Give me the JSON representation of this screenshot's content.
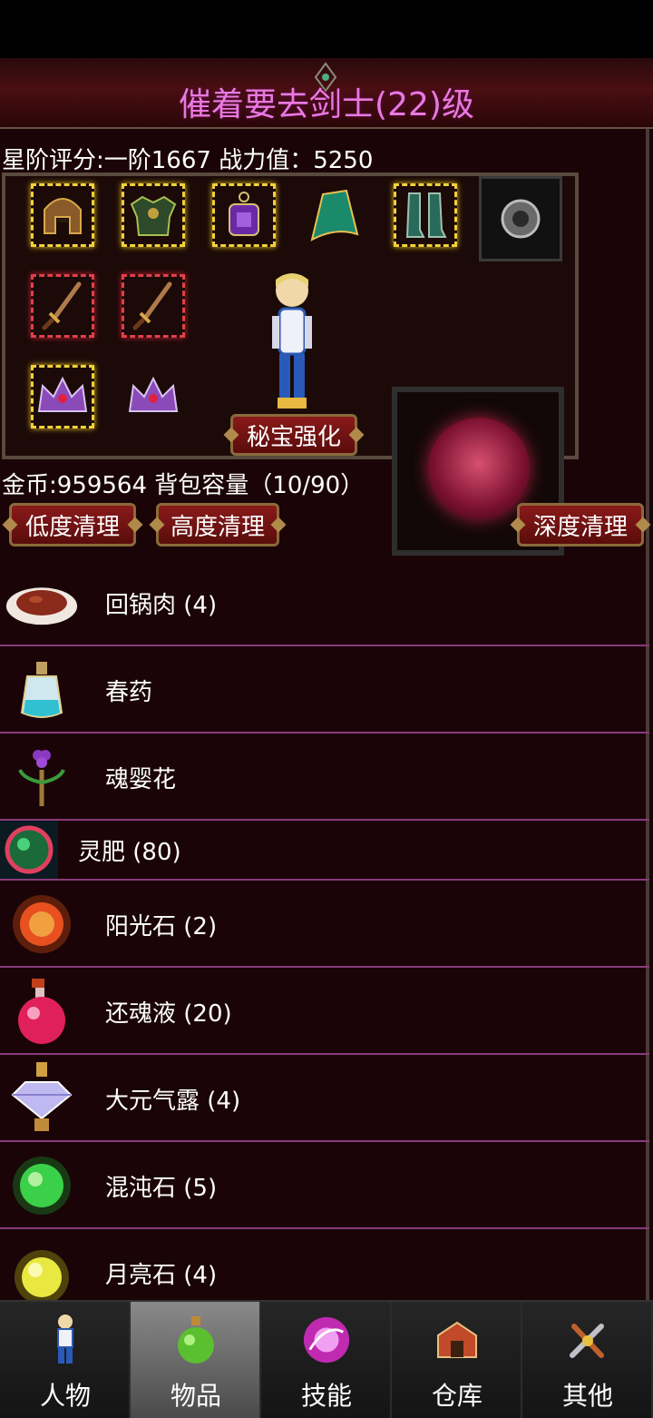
{
  "header": {
    "title": "催着要去剑士(22)级"
  },
  "stats": {
    "score_line": "星阶评分:一阶1667 战力值：5250"
  },
  "equipment": {
    "enhance_button": "秘宝强化",
    "slots": [
      {
        "icon": "helmet-icon",
        "state": "gold"
      },
      {
        "icon": "armor-icon",
        "state": "gold"
      },
      {
        "icon": "amulet-icon",
        "state": "gold"
      },
      {
        "icon": "cape-icon",
        "state": "gold"
      },
      {
        "icon": "boots-icon",
        "state": "gold"
      },
      {
        "icon": "ring-icon",
        "state": "plain"
      },
      {
        "icon": "sword-icon",
        "state": "red"
      },
      {
        "icon": "sword-icon",
        "state": "red"
      },
      {
        "icon": "crown-icon",
        "state": "gold"
      },
      {
        "icon": "crown-icon",
        "state": "none"
      }
    ],
    "pet_icon": "tiger-icon"
  },
  "inventory": {
    "gold_line": "金币:959564 背包容量（10/90）",
    "clean_low": "低度清理",
    "clean_high": "高度清理",
    "clean_deep": "深度清理",
    "items": [
      {
        "name": "回锅肉 (4)",
        "icon": "meat-dish-icon"
      },
      {
        "name": "春药",
        "icon": "potion-bottle-icon"
      },
      {
        "name": "魂婴花",
        "icon": "flower-icon"
      },
      {
        "name": "灵肥 (80)",
        "icon": "orb-icon"
      },
      {
        "name": "阳光石 (2)",
        "icon": "sun-stone-icon"
      },
      {
        "name": "还魂液 (20)",
        "icon": "red-potion-icon"
      },
      {
        "name": "大元气露 (4)",
        "icon": "diamond-icon"
      },
      {
        "name": "混沌石 (5)",
        "icon": "green-stone-icon"
      },
      {
        "name": "月亮石 (4)",
        "icon": "moon-stone-icon"
      }
    ]
  },
  "tabs": [
    {
      "label": "人物",
      "icon": "character-icon",
      "active": false
    },
    {
      "label": "物品",
      "icon": "items-icon",
      "active": true
    },
    {
      "label": "技能",
      "icon": "skills-icon",
      "active": false
    },
    {
      "label": "仓库",
      "icon": "warehouse-icon",
      "active": false
    },
    {
      "label": "其他",
      "icon": "other-icon",
      "active": false
    }
  ],
  "colors": {
    "title": "#e879e0",
    "gold_slot": "#f1d23a",
    "red_slot": "#e0404a",
    "row_divider": "#8a3a7a"
  }
}
